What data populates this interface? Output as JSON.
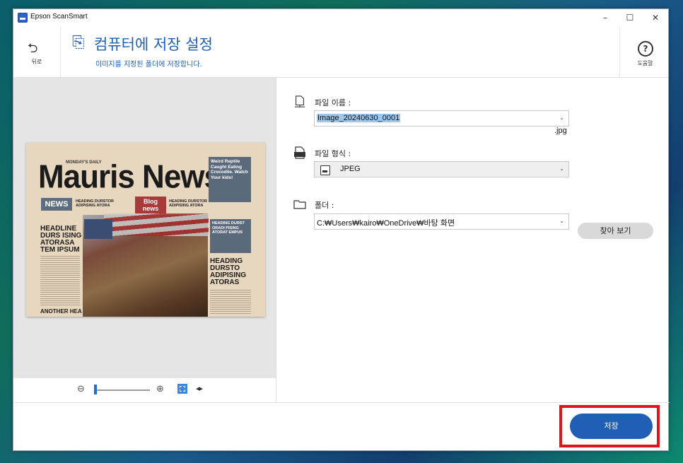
{
  "window": {
    "title": "Epson ScanSmart",
    "controls": {
      "minimize": "–",
      "maximize": "☐",
      "close": "✕"
    }
  },
  "header": {
    "back_label": "뒤로",
    "title": "컴퓨터에 저장 설정",
    "subtitle": "이미지를 지정된 폴더에 저장합니다.",
    "help_label": "도움말"
  },
  "preview": {
    "newspaper": {
      "daily": "MONDAY'S DAILY",
      "masthead": "Mauris News",
      "side_box": "Weird Reptile Caught Eating Crocodile. Watch Your kids!",
      "news_tag": "NEWS",
      "heading_left": "HEADING DURSTOR ADIPISING ATORA",
      "blog_tag": "Blog news",
      "heading_right": "HEADING DURSTOR ADIPISING ATORA",
      "headline": "HEADLINE DURS ISING ATORASA TEM IPSUM",
      "right_box": "HEADING DURST ORADI PISING ATORAT EMPUS",
      "right_heading": "HEADING DURSTO ADIPISING ATORAS",
      "another": "ANOTHER HEA"
    },
    "zoom_level": 0.0
  },
  "form": {
    "filename": {
      "label": "파일 이름 :",
      "value": "Image_20240630_0001",
      "extension": ".jpg"
    },
    "format": {
      "label": "파일 형식 :",
      "value": "JPEG"
    },
    "folder": {
      "label": "폴더 :",
      "value": "C:₩Users₩kairo₩OneDrive₩바탕 화면",
      "browse_label": "찾아 보기"
    }
  },
  "footer": {
    "save_label": "저장"
  },
  "colors": {
    "accent": "#1f5fb5",
    "highlight": "#e0151b"
  }
}
